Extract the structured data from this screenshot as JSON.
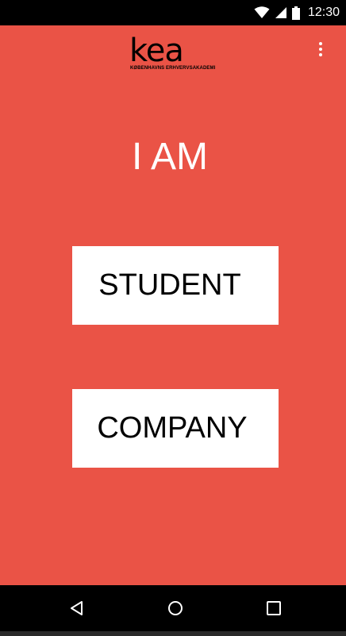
{
  "status_bar": {
    "time": "12:30",
    "icons": [
      "wifi-icon",
      "cell-signal-icon",
      "battery-icon"
    ]
  },
  "header": {
    "logo_text": "kea",
    "logo_subtitle": "KØBENHAVNS ERHVERVSAKADEMI",
    "menu_icon": "more-vertical-icon"
  },
  "main": {
    "heading": "I AM",
    "buttons": [
      {
        "label": "STUDENT"
      },
      {
        "label": "COMPANY"
      }
    ]
  },
  "nav_bar": {
    "icons": [
      "back-icon",
      "home-icon",
      "recents-icon"
    ]
  },
  "colors": {
    "background": "#ea5346",
    "button_background": "#ffffff",
    "heading_text": "#ffffff",
    "button_text": "#000000",
    "bars": "#000000"
  }
}
